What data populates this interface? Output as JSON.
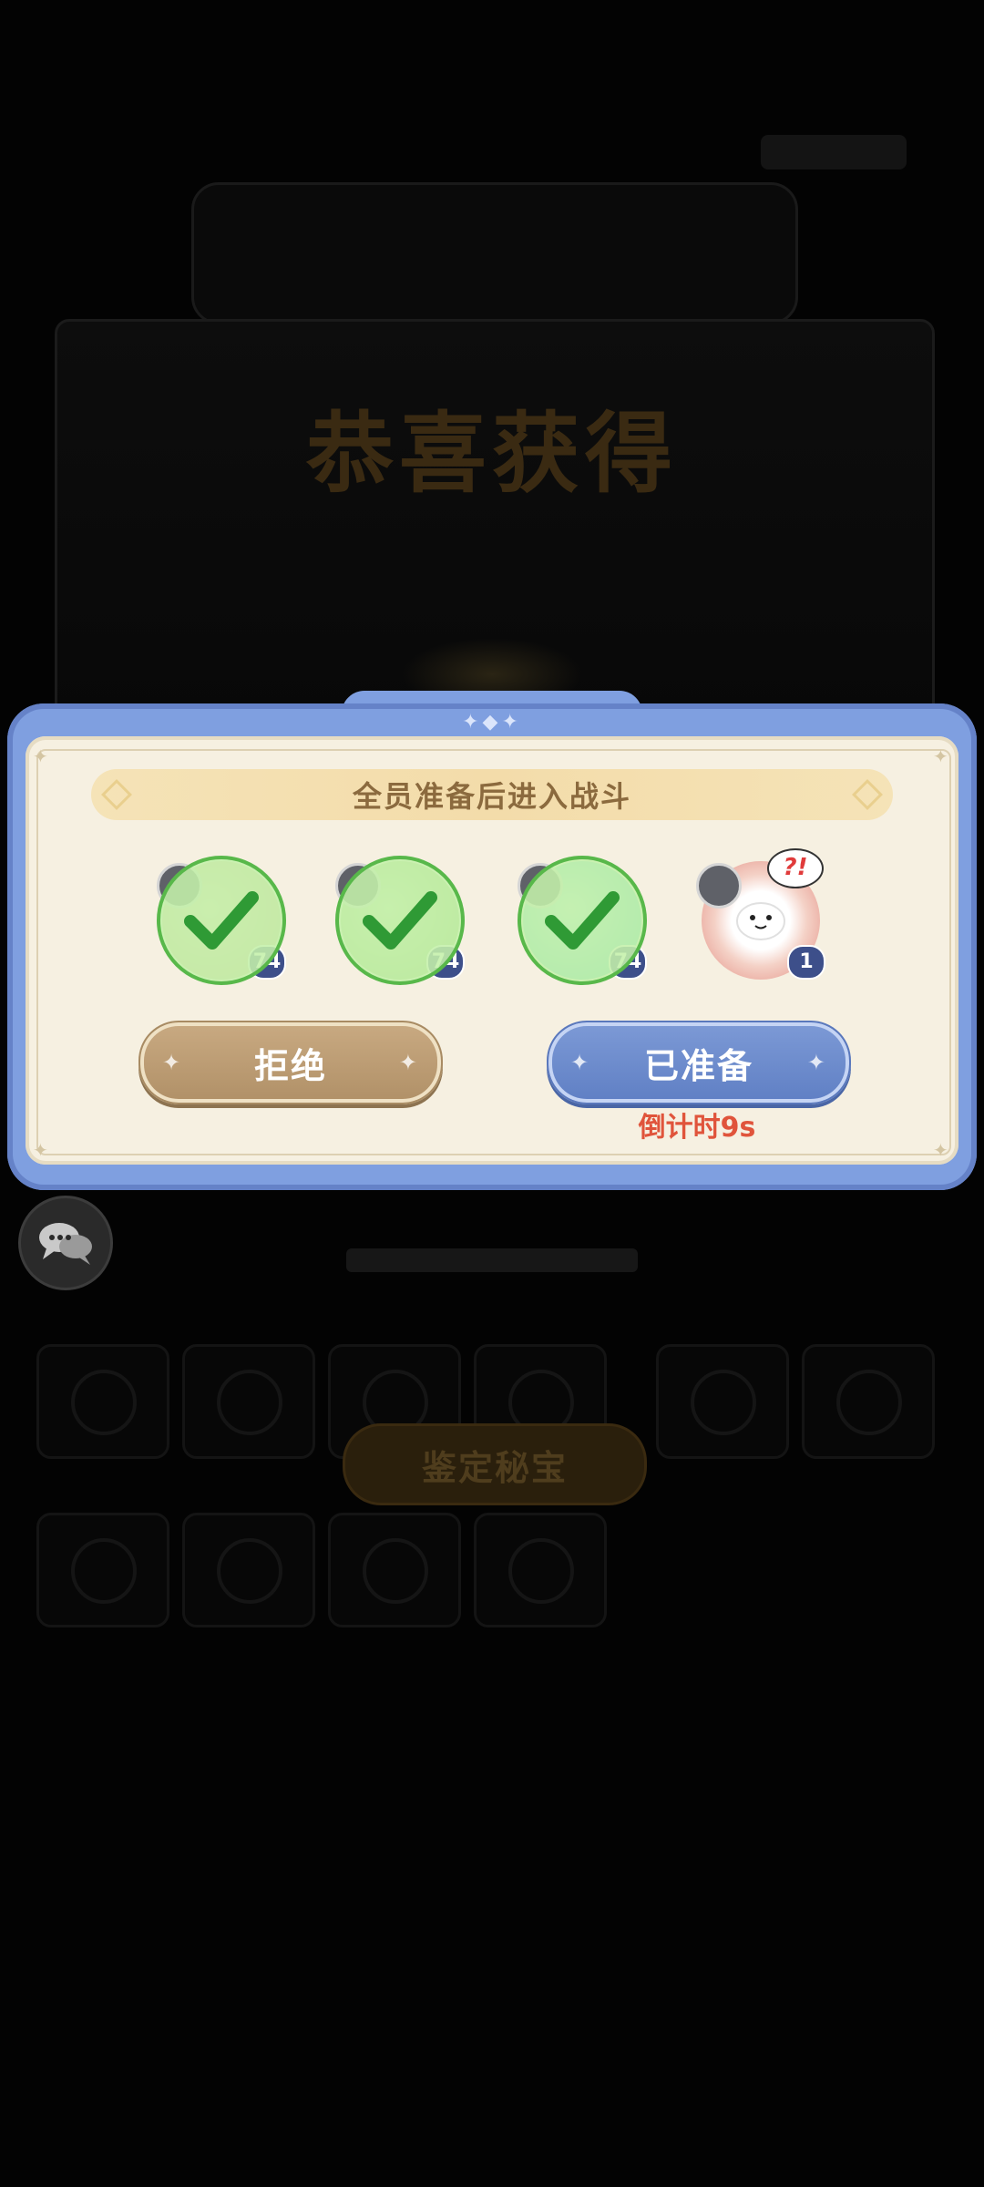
{
  "background": {
    "title": "恭喜获得",
    "appraise_button": "鉴定秘宝"
  },
  "dialog": {
    "banner": "全员准备后进入战斗",
    "players": [
      {
        "slot": 1,
        "ready": true,
        "level": "74"
      },
      {
        "slot": 2,
        "ready": true,
        "level": "74"
      },
      {
        "slot": 3,
        "ready": true,
        "level": "74"
      },
      {
        "slot": 4,
        "ready": false,
        "level": "1",
        "badge_text": "?!"
      }
    ],
    "refuse_label": "拒绝",
    "ready_label": "已准备",
    "countdown": "倒计时9s"
  },
  "icons": {
    "chat": "chat-bubbles-icon",
    "ready": "checkmark-icon"
  },
  "colors": {
    "dialog_frame": "#7f9fe0",
    "dialog_body": "#f6f0e1",
    "refuse_button": "#b99a72",
    "ready_button": "#6f8dcf",
    "countdown": "#e0543b",
    "ready_overlay": "#c4f0aa"
  }
}
